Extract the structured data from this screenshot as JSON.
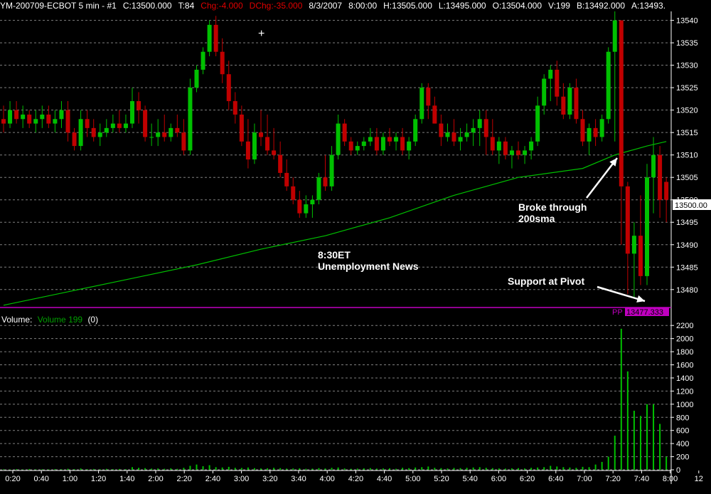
{
  "header": {
    "symbol": "YM-200709-ECBOT  5 min  - #1",
    "close": "C:13500.000",
    "ticks": "T:84",
    "change": "Chg:-4.000",
    "dchange": "DChg:-35.000",
    "date": "8/3/2007",
    "time": "8:00:00",
    "high": "H:13505.000",
    "low": "L:13495.000",
    "open": "O:13504.000",
    "volume": "V:199",
    "bid": "B:13492.000",
    "ask": "A:13493."
  },
  "colors": {
    "up": "#00c000",
    "down": "#c00000",
    "sma": "#00c000",
    "pivot": "#c000c0",
    "grid": "#808080",
    "background": "#000000"
  },
  "crosshair": "+",
  "annotations": {
    "news_line1": "8:30ET",
    "news_line2": "Unemployment News",
    "sma_line1": "Broke through",
    "sma_line2": "200sma",
    "pivot": "Support at Pivot"
  },
  "pivot_label": {
    "name": "PP",
    "value": "13477.333"
  },
  "price_axis": {
    "current_label": "13500.00"
  },
  "volume_panel": {
    "label": "Volume:",
    "series_label": "Volume  199",
    "extra": "(0)"
  },
  "chart_data": {
    "type": "candlestick",
    "timeframe": "5 min",
    "price_axis": {
      "min": 13476,
      "max": 13542,
      "ticks": [
        13480,
        13485,
        13490,
        13495,
        13500,
        13505,
        13510,
        13515,
        13520,
        13525,
        13530,
        13535,
        13540
      ]
    },
    "volume_axis": {
      "min": 0,
      "max": 2300,
      "ticks": [
        0,
        200,
        400,
        600,
        800,
        1000,
        1200,
        1400,
        1600,
        1800,
        2000,
        2200
      ]
    },
    "time_labels": [
      "0:20",
      "0:40",
      "1:00",
      "1:20",
      "1:40",
      "2:00",
      "2:20",
      "2:40",
      "3:00",
      "3:20",
      "3:40",
      "4:00",
      "4:20",
      "4:40",
      "5:00",
      "5:20",
      "5:40",
      "6:00",
      "6:20",
      "6:40",
      "7:00",
      "7:20",
      "7:40",
      "8:00",
      "12"
    ],
    "pivot": 13477.333,
    "candles": [
      {
        "o": 13518,
        "h": 13521,
        "l": 13515,
        "c": 13517
      },
      {
        "o": 13517,
        "h": 13522,
        "l": 13516,
        "c": 13520
      },
      {
        "o": 13520,
        "h": 13522,
        "l": 13517,
        "c": 13518
      },
      {
        "o": 13518,
        "h": 13521,
        "l": 13516,
        "c": 13519
      },
      {
        "o": 13519,
        "h": 13520,
        "l": 13516,
        "c": 13517
      },
      {
        "o": 13517,
        "h": 13520,
        "l": 13515,
        "c": 13518
      },
      {
        "o": 13518,
        "h": 13521,
        "l": 13516,
        "c": 13519
      },
      {
        "o": 13519,
        "h": 13521,
        "l": 13516,
        "c": 13517
      },
      {
        "o": 13517,
        "h": 13520,
        "l": 13515,
        "c": 13518
      },
      {
        "o": 13518,
        "h": 13522,
        "l": 13516,
        "c": 13520
      },
      {
        "o": 13520,
        "h": 13522,
        "l": 13513,
        "c": 13515
      },
      {
        "o": 13515,
        "h": 13516,
        "l": 13511,
        "c": 13512
      },
      {
        "o": 13512,
        "h": 13520,
        "l": 13511,
        "c": 13518
      },
      {
        "o": 13518,
        "h": 13520,
        "l": 13514,
        "c": 13516
      },
      {
        "o": 13516,
        "h": 13518,
        "l": 13513,
        "c": 13514
      },
      {
        "o": 13514,
        "h": 13517,
        "l": 13512,
        "c": 13515
      },
      {
        "o": 13515,
        "h": 13518,
        "l": 13514,
        "c": 13516
      },
      {
        "o": 13516,
        "h": 13519,
        "l": 13515,
        "c": 13517
      },
      {
        "o": 13517,
        "h": 13520,
        "l": 13515,
        "c": 13516
      },
      {
        "o": 13516,
        "h": 13519,
        "l": 13515,
        "c": 13517
      },
      {
        "o": 13517,
        "h": 13525,
        "l": 13516,
        "c": 13522
      },
      {
        "o": 13522,
        "h": 13524,
        "l": 13517,
        "c": 13520
      },
      {
        "o": 13520,
        "h": 13521,
        "l": 13513,
        "c": 13514
      },
      {
        "o": 13514,
        "h": 13517,
        "l": 13512,
        "c": 13514
      },
      {
        "o": 13514,
        "h": 13518,
        "l": 13512,
        "c": 13515
      },
      {
        "o": 13515,
        "h": 13519,
        "l": 13513,
        "c": 13514
      },
      {
        "o": 13514,
        "h": 13517,
        "l": 13513,
        "c": 13516
      },
      {
        "o": 13516,
        "h": 13519,
        "l": 13514,
        "c": 13515
      },
      {
        "o": 13515,
        "h": 13518,
        "l": 13510,
        "c": 13511
      },
      {
        "o": 13511,
        "h": 13527,
        "l": 13510,
        "c": 13525
      },
      {
        "o": 13525,
        "h": 13530,
        "l": 13524,
        "c": 13529
      },
      {
        "o": 13529,
        "h": 13534,
        "l": 13528,
        "c": 13533
      },
      {
        "o": 13533,
        "h": 13540,
        "l": 13532,
        "c": 13539
      },
      {
        "o": 13539,
        "h": 13541,
        "l": 13532,
        "c": 13533
      },
      {
        "o": 13533,
        "h": 13536,
        "l": 13526,
        "c": 13528
      },
      {
        "o": 13528,
        "h": 13531,
        "l": 13520,
        "c": 13522
      },
      {
        "o": 13522,
        "h": 13524,
        "l": 13517,
        "c": 13519
      },
      {
        "o": 13519,
        "h": 13521,
        "l": 13512,
        "c": 13513
      },
      {
        "o": 13513,
        "h": 13518,
        "l": 13507,
        "c": 13509
      },
      {
        "o": 13509,
        "h": 13517,
        "l": 13508,
        "c": 13515
      },
      {
        "o": 13515,
        "h": 13520,
        "l": 13512,
        "c": 13514
      },
      {
        "o": 13514,
        "h": 13519,
        "l": 13510,
        "c": 13511
      },
      {
        "o": 13511,
        "h": 13516,
        "l": 13509,
        "c": 13510
      },
      {
        "o": 13510,
        "h": 13513,
        "l": 13505,
        "c": 13506
      },
      {
        "o": 13506,
        "h": 13509,
        "l": 13502,
        "c": 13503
      },
      {
        "o": 13503,
        "h": 13505,
        "l": 13499,
        "c": 13500
      },
      {
        "o": 13500,
        "h": 13502,
        "l": 13496,
        "c": 13497
      },
      {
        "o": 13497,
        "h": 13501,
        "l": 13496,
        "c": 13499
      },
      {
        "o": 13499,
        "h": 13501,
        "l": 13496,
        "c": 13500
      },
      {
        "o": 13500,
        "h": 13506,
        "l": 13499,
        "c": 13505
      },
      {
        "o": 13505,
        "h": 13510,
        "l": 13502,
        "c": 13503
      },
      {
        "o": 13503,
        "h": 13512,
        "l": 13502,
        "c": 13510
      },
      {
        "o": 13510,
        "h": 13519,
        "l": 13509,
        "c": 13517
      },
      {
        "o": 13517,
        "h": 13518,
        "l": 13512,
        "c": 13513
      },
      {
        "o": 13513,
        "h": 13514,
        "l": 13510,
        "c": 13511
      },
      {
        "o": 13511,
        "h": 13513,
        "l": 13510,
        "c": 13512
      },
      {
        "o": 13512,
        "h": 13514,
        "l": 13511,
        "c": 13513
      },
      {
        "o": 13513,
        "h": 13516,
        "l": 13512,
        "c": 13514
      },
      {
        "o": 13514,
        "h": 13516,
        "l": 13510,
        "c": 13511
      },
      {
        "o": 13511,
        "h": 13515,
        "l": 13510,
        "c": 13514
      },
      {
        "o": 13514,
        "h": 13516,
        "l": 13512,
        "c": 13513
      },
      {
        "o": 13513,
        "h": 13515,
        "l": 13511,
        "c": 13514
      },
      {
        "o": 13514,
        "h": 13516,
        "l": 13510,
        "c": 13511
      },
      {
        "o": 13511,
        "h": 13514,
        "l": 13509,
        "c": 13513
      },
      {
        "o": 13513,
        "h": 13519,
        "l": 13512,
        "c": 13518
      },
      {
        "o": 13518,
        "h": 13526,
        "l": 13517,
        "c": 13525
      },
      {
        "o": 13525,
        "h": 13526,
        "l": 13518,
        "c": 13521
      },
      {
        "o": 13521,
        "h": 13523,
        "l": 13517,
        "c": 13517
      },
      {
        "o": 13517,
        "h": 13519,
        "l": 13512,
        "c": 13514
      },
      {
        "o": 13514,
        "h": 13517,
        "l": 13513,
        "c": 13515
      },
      {
        "o": 13515,
        "h": 13518,
        "l": 13512,
        "c": 13513
      },
      {
        "o": 13513,
        "h": 13516,
        "l": 13511,
        "c": 13514
      },
      {
        "o": 13514,
        "h": 13517,
        "l": 13513,
        "c": 13515
      },
      {
        "o": 13515,
        "h": 13518,
        "l": 13512,
        "c": 13516
      },
      {
        "o": 13516,
        "h": 13520,
        "l": 13512,
        "c": 13518
      },
      {
        "o": 13518,
        "h": 13520,
        "l": 13510,
        "c": 13514
      },
      {
        "o": 13514,
        "h": 13518,
        "l": 13510,
        "c": 13511
      },
      {
        "o": 13511,
        "h": 13514,
        "l": 13508,
        "c": 13513
      },
      {
        "o": 13513,
        "h": 13514,
        "l": 13509,
        "c": 13510
      },
      {
        "o": 13510,
        "h": 13512,
        "l": 13507,
        "c": 13511
      },
      {
        "o": 13511,
        "h": 13513,
        "l": 13509,
        "c": 13510
      },
      {
        "o": 13510,
        "h": 13512,
        "l": 13508,
        "c": 13511
      },
      {
        "o": 13511,
        "h": 13514,
        "l": 13509,
        "c": 13513
      },
      {
        "o": 13513,
        "h": 13523,
        "l": 13512,
        "c": 13521
      },
      {
        "o": 13521,
        "h": 13528,
        "l": 13519,
        "c": 13527
      },
      {
        "o": 13527,
        "h": 13530,
        "l": 13522,
        "c": 13529
      },
      {
        "o": 13529,
        "h": 13531,
        "l": 13521,
        "c": 13523
      },
      {
        "o": 13523,
        "h": 13526,
        "l": 13518,
        "c": 13519
      },
      {
        "o": 13519,
        "h": 13526,
        "l": 13518,
        "c": 13525
      },
      {
        "o": 13525,
        "h": 13527,
        "l": 13517,
        "c": 13518
      },
      {
        "o": 13518,
        "h": 13520,
        "l": 13512,
        "c": 13513
      },
      {
        "o": 13513,
        "h": 13517,
        "l": 13510,
        "c": 13516
      },
      {
        "o": 13516,
        "h": 13518,
        "l": 13512,
        "c": 13514
      },
      {
        "o": 13514,
        "h": 13519,
        "l": 13513,
        "c": 13518
      },
      {
        "o": 13518,
        "h": 13534,
        "l": 13517,
        "c": 13533
      },
      {
        "o": 13533,
        "h": 13542,
        "l": 13513,
        "c": 13540
      },
      {
        "o": 13540,
        "h": 13540,
        "l": 13490,
        "c": 13503
      },
      {
        "o": 13503,
        "h": 13504,
        "l": 13479,
        "c": 13488
      },
      {
        "o": 13488,
        "h": 13495,
        "l": 13478,
        "c": 13492
      },
      {
        "o": 13492,
        "h": 13501,
        "l": 13481,
        "c": 13483
      },
      {
        "o": 13483,
        "h": 13508,
        "l": 13481,
        "c": 13505
      },
      {
        "o": 13505,
        "h": 13514,
        "l": 13497,
        "c": 13510
      },
      {
        "o": 13510,
        "h": 13512,
        "l": 13496,
        "c": 13500
      },
      {
        "o": 13504,
        "h": 13505,
        "l": 13495,
        "c": 13500
      }
    ],
    "sma": [
      {
        "i": 0,
        "v": 13476.5
      },
      {
        "i": 10,
        "v": 13479.5
      },
      {
        "i": 20,
        "v": 13482.5
      },
      {
        "i": 30,
        "v": 13485.5
      },
      {
        "i": 40,
        "v": 13489
      },
      {
        "i": 50,
        "v": 13492
      },
      {
        "i": 60,
        "v": 13496
      },
      {
        "i": 70,
        "v": 13501
      },
      {
        "i": 80,
        "v": 13505
      },
      {
        "i": 90,
        "v": 13507
      },
      {
        "i": 95,
        "v": 13510
      },
      {
        "i": 100,
        "v": 13512
      },
      {
        "i": 103,
        "v": 13513
      }
    ],
    "volume": [
      8,
      5,
      10,
      6,
      12,
      7,
      9,
      6,
      11,
      8,
      15,
      10,
      20,
      9,
      12,
      8,
      14,
      10,
      12,
      9,
      40,
      30,
      25,
      18,
      20,
      15,
      22,
      14,
      30,
      60,
      80,
      55,
      70,
      40,
      35,
      45,
      30,
      28,
      35,
      25,
      20,
      22,
      30,
      25,
      18,
      20,
      22,
      15,
      18,
      25,
      20,
      30,
      35,
      20,
      15,
      18,
      22,
      25,
      18,
      20,
      22,
      15,
      30,
      25,
      35,
      40,
      50,
      30,
      25,
      20,
      28,
      25,
      30,
      35,
      40,
      30,
      25,
      20,
      18,
      22,
      25,
      20,
      30,
      35,
      40,
      60,
      50,
      40,
      35,
      30,
      45,
      40,
      80,
      120,
      200,
      520,
      2150,
      1500,
      900,
      820,
      1000,
      1000,
      700,
      199
    ]
  }
}
